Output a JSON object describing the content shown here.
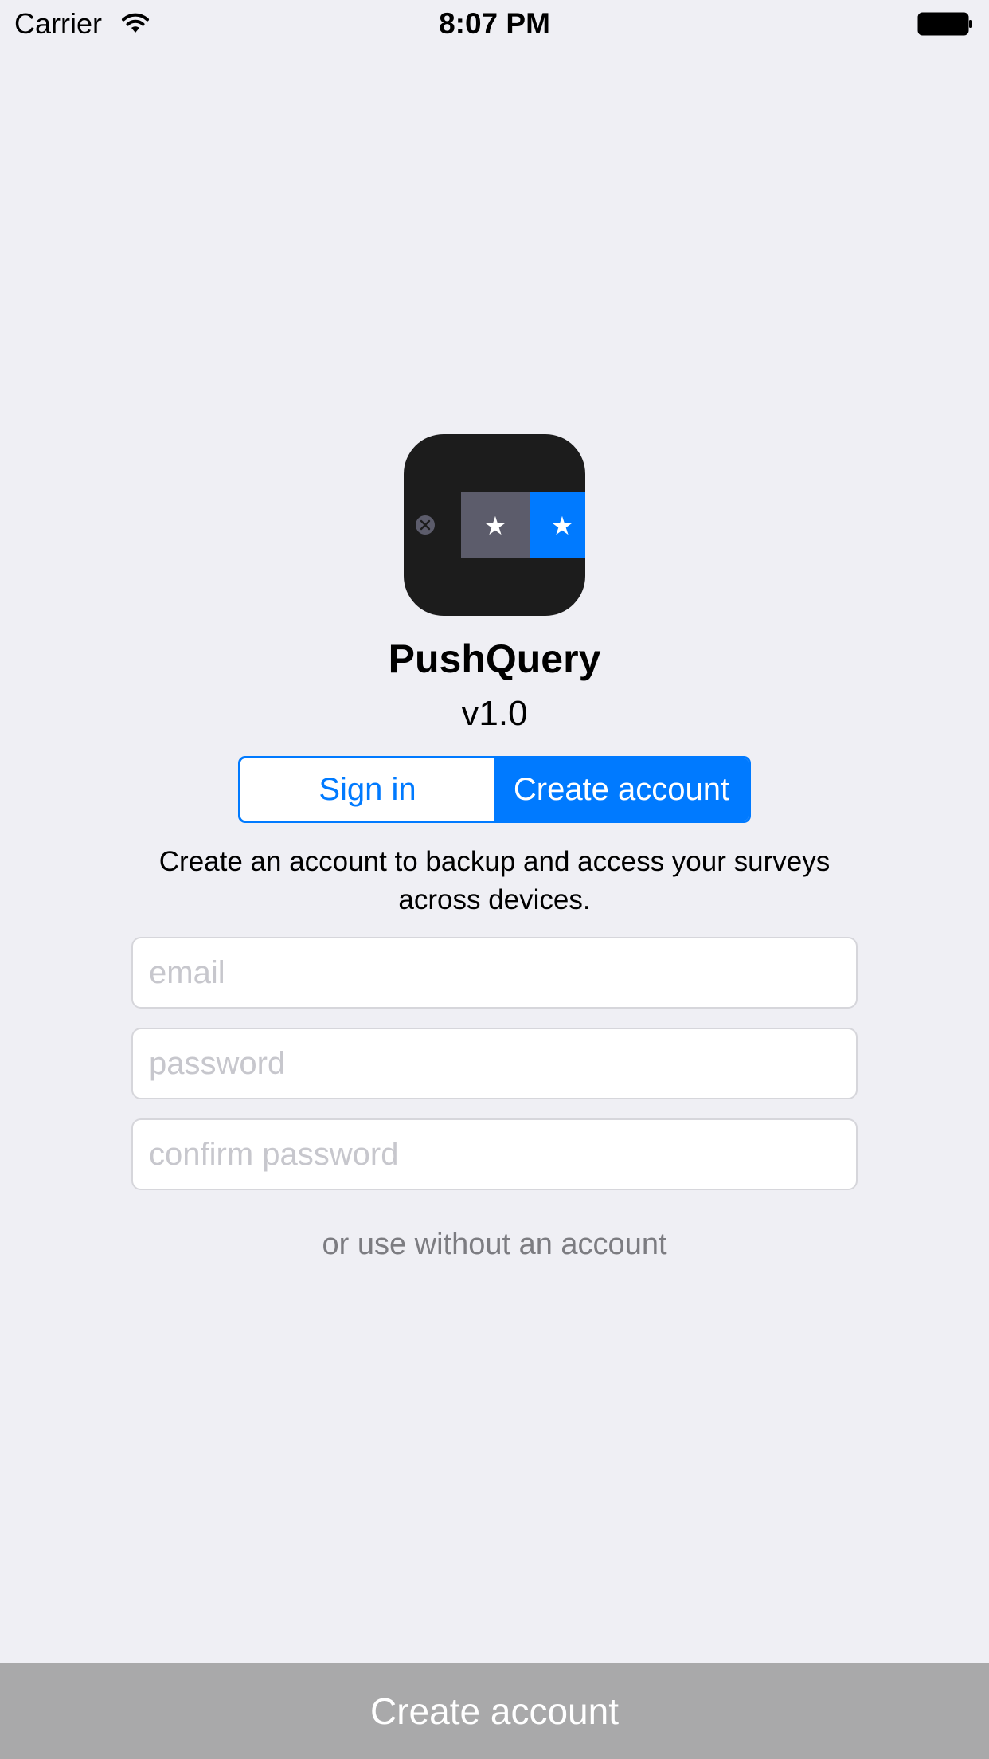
{
  "status_bar": {
    "carrier": "Carrier",
    "time": "8:07 PM",
    "wifi_icon": "wifi-icon",
    "battery_icon": "battery-icon"
  },
  "app": {
    "icon": "app-logo-icon",
    "name": "PushQuery",
    "version": "v1.0"
  },
  "auth_tabs": {
    "items": [
      {
        "label": "Sign in",
        "selected": false
      },
      {
        "label": "Create account",
        "selected": true
      }
    ]
  },
  "description": "Create an account to backup and access your surveys across devices.",
  "form": {
    "email": {
      "placeholder": "email",
      "value": ""
    },
    "password": {
      "placeholder": "password",
      "value": ""
    },
    "confirm_password": {
      "placeholder": "confirm password",
      "value": ""
    }
  },
  "skip_link": "or use without an account",
  "submit_button": {
    "label": "Create account",
    "enabled": false
  },
  "colors": {
    "background": "#efeff4",
    "accent": "#007aff",
    "disabled_button": "#a9a9aa",
    "placeholder": "#c7c7cd",
    "secondary_text": "#7c7c81",
    "icon_dark": "#1c1c1c",
    "icon_gray": "#5c5c6b"
  }
}
